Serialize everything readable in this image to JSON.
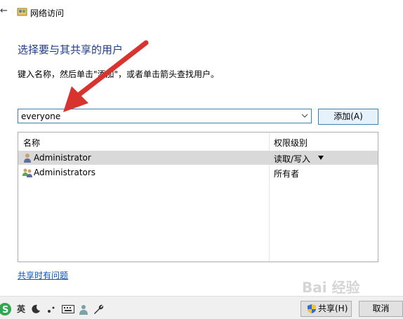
{
  "window": {
    "title": "网络访问",
    "back_glyph": "←"
  },
  "heading": "选择要与其共享的用户",
  "instruction": "键入名称，然后单击\"添加\"，或者单击箭头查找用户。",
  "user_input": {
    "value": "everyone"
  },
  "add_button_label": "添加(A)",
  "list": {
    "columns": [
      "名称",
      "权限级别"
    ],
    "rows": [
      {
        "name": "Administrator",
        "permission": "读取/写入",
        "selected": true
      },
      {
        "name": "Administrators",
        "permission": "所有者",
        "selected": false
      }
    ]
  },
  "help_link": "共享时有问题",
  "share_button_label": "共享(H)",
  "cancel_button_label": "取消",
  "ime_toolbar": {
    "mode_label": "英"
  },
  "watermark": {
    "text": "Bai 经验"
  },
  "colors": {
    "accent": "#3c7fb1",
    "heading": "#1e3b8a",
    "link": "#0b55b8",
    "annotation": "#d9332f",
    "selected_row": "#d9d9d9"
  }
}
